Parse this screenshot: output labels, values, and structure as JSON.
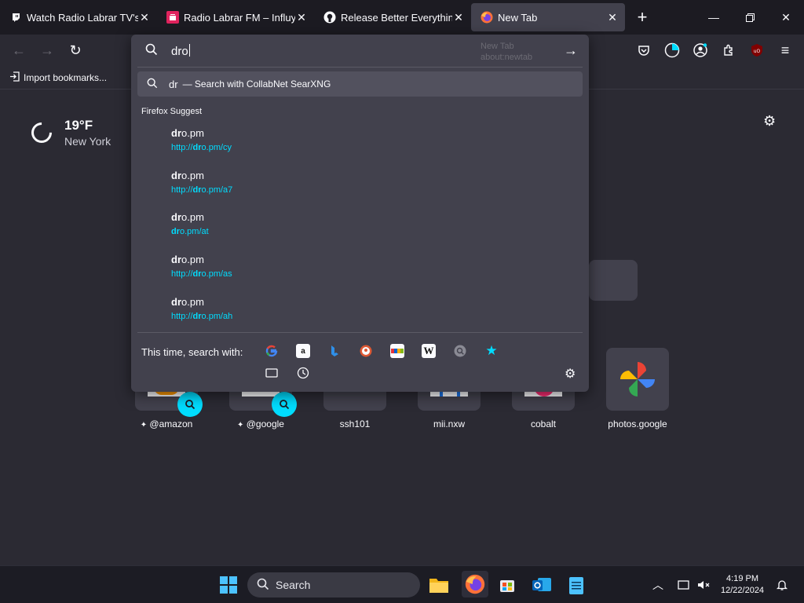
{
  "tabs": [
    {
      "title": "Watch Radio Labrar TV's St",
      "favicon": "twitch-icon",
      "active": false
    },
    {
      "title": "Radio Labrar FM – Influye t",
      "favicon": "radio-icon",
      "active": false
    },
    {
      "title": "Release Better Everything –",
      "favicon": "github-icon",
      "active": false
    },
    {
      "title": "New Tab",
      "favicon": "firefox-icon",
      "active": true
    }
  ],
  "bookmarks": {
    "import_label": "Import bookmarks..."
  },
  "urlbar": {
    "typed": "dro",
    "ghost_title": "New Tab",
    "ghost_url": "about:newtab",
    "search_prefix": "dr",
    "search_suffix": "— Search with CollabNet SearXNG",
    "group_label": "Firefox Suggest",
    "suggestions": [
      {
        "title_bold": "dr",
        "title_rest": "o.pm",
        "url_pre": "http://",
        "url_bold": "dr",
        "url_post": "o.pm/cy"
      },
      {
        "title_bold": "dr",
        "title_rest": "o.pm",
        "url_pre": "http://",
        "url_bold": "dr",
        "url_post": "o.pm/a7"
      },
      {
        "title_bold": "dr",
        "title_rest": "o.pm",
        "url_pre": "",
        "url_bold": "dr",
        "url_post": "o.pm/at"
      },
      {
        "title_bold": "dr",
        "title_rest": "o.pm",
        "url_pre": "http://",
        "url_bold": "dr",
        "url_post": "o.pm/as"
      },
      {
        "title_bold": "dr",
        "title_rest": "o.pm",
        "url_pre": "http://",
        "url_bold": "dr",
        "url_post": "o.pm/ah"
      }
    ],
    "oneoff_label": "This time, search with:",
    "engines": [
      "google-icon",
      "amazon-icon",
      "bing-icon",
      "duckduckgo-icon",
      "ebay-icon",
      "wikipedia-icon",
      "searxng-icon",
      "bookmarks-star-icon",
      "tabs-icon",
      "history-icon"
    ]
  },
  "weather": {
    "temp": "19°F",
    "city": "New York"
  },
  "tiles": [
    {
      "label": "@amazon",
      "pinned": true
    },
    {
      "label": "@google",
      "pinned": true
    },
    {
      "label": "ssh101",
      "pinned": false
    },
    {
      "label": "mii.nxw",
      "pinned": false
    },
    {
      "label": "cobalt",
      "pinned": false
    },
    {
      "label": "photos.google",
      "pinned": false
    }
  ],
  "taskbar": {
    "search_label": "Search",
    "time": "4:19 PM",
    "date": "12/22/2024"
  },
  "colors": {
    "accent": "#00ddff",
    "panel": "#42414d",
    "page": "#2b2a33"
  }
}
